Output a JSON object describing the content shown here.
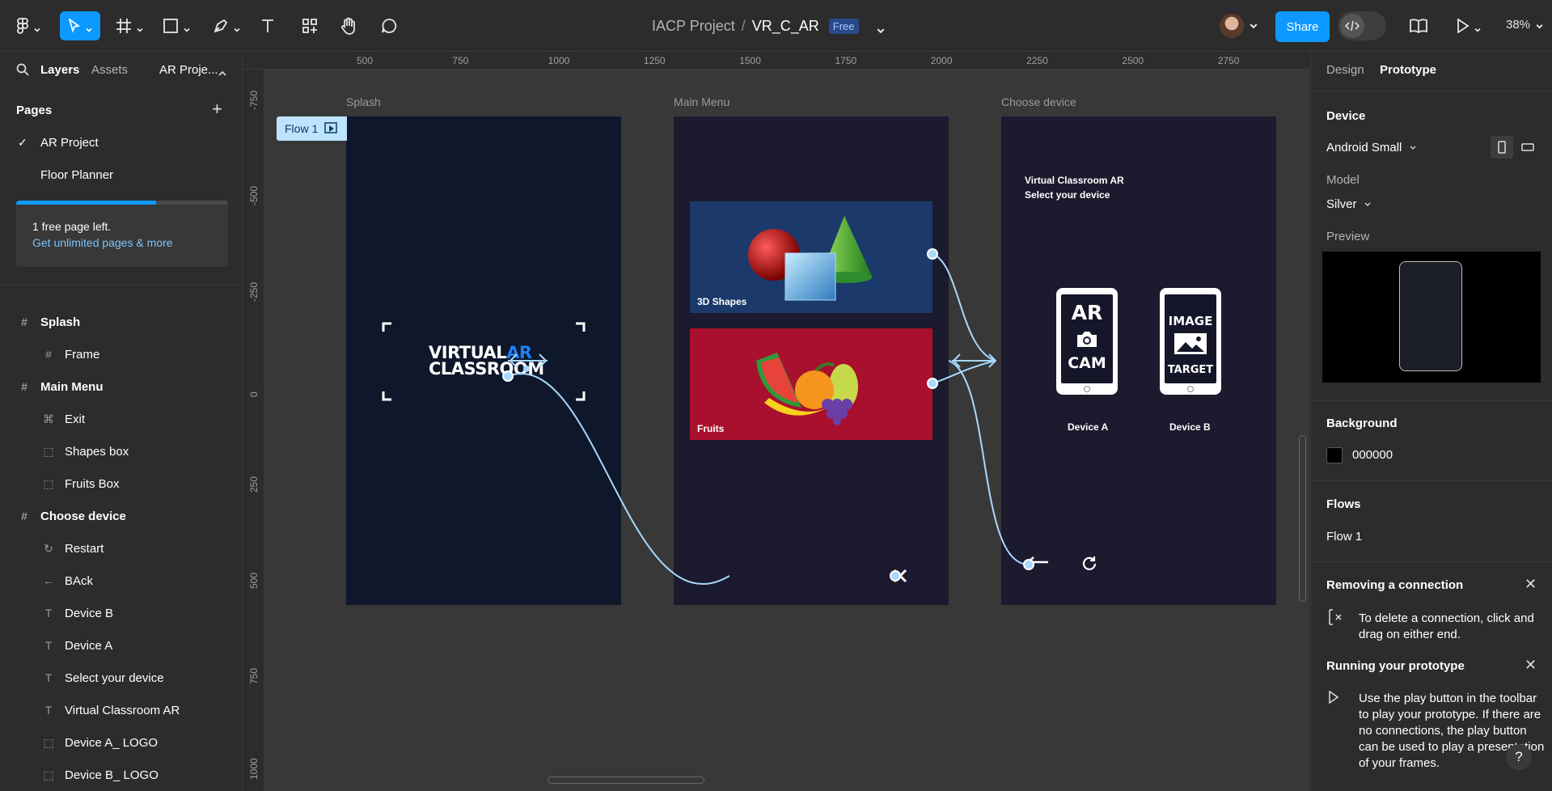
{
  "toolbar": {
    "project": "IACP Project",
    "separator": "/",
    "file": "VR_C_AR",
    "plan_badge": "Free",
    "share_label": "Share",
    "zoom": "38%"
  },
  "left_panel": {
    "tabs": {
      "layers": "Layers",
      "assets": "Assets",
      "page_switch": "AR Proje..."
    },
    "pages_title": "Pages",
    "pages": [
      {
        "label": "AR Project",
        "active": true
      },
      {
        "label": "Floor Planner",
        "active": false
      }
    ],
    "upsell": {
      "text": "1 free page left.",
      "link": "Get unlimited pages & more",
      "progress": 0.66
    },
    "layers": [
      {
        "label": "Splash",
        "icon": "frame-icon",
        "glyph": "#",
        "level": 0
      },
      {
        "label": "Frame",
        "icon": "frame-icon",
        "glyph": "#",
        "level": 1
      },
      {
        "label": "Main Menu",
        "icon": "frame-icon",
        "glyph": "#",
        "level": 0
      },
      {
        "label": "Exit",
        "icon": "component-icon",
        "glyph": "⌘",
        "level": 1
      },
      {
        "label": "Shapes box",
        "icon": "group-icon",
        "glyph": "⬚",
        "level": 1
      },
      {
        "label": "Fruits Box",
        "icon": "group-icon",
        "glyph": "⬚",
        "level": 1
      },
      {
        "label": "Choose device",
        "icon": "frame-icon",
        "glyph": "#",
        "level": 0
      },
      {
        "label": "Restart",
        "icon": "restart-icon",
        "glyph": "↻",
        "level": 1
      },
      {
        "label": "BAck",
        "icon": "arrow-left-icon",
        "glyph": "←",
        "level": 1
      },
      {
        "label": "Device B",
        "icon": "text-icon",
        "glyph": "T",
        "level": 1
      },
      {
        "label": "Device A",
        "icon": "text-icon",
        "glyph": "T",
        "level": 1
      },
      {
        "label": "Select your device",
        "icon": "text-icon",
        "glyph": "T",
        "level": 1
      },
      {
        "label": "Virtual Classroom AR",
        "icon": "text-icon",
        "glyph": "T",
        "level": 1
      },
      {
        "label": "Device A_ LOGO",
        "icon": "group-icon",
        "glyph": "⬚",
        "level": 1
      },
      {
        "label": "Device B_ LOGO",
        "icon": "group-icon",
        "glyph": "⬚",
        "level": 1
      }
    ]
  },
  "rulers": {
    "top": [
      "500",
      "750",
      "1000",
      "1250",
      "1500",
      "1750",
      "2000",
      "2250",
      "2500",
      "2750"
    ],
    "left": [
      "-750",
      "-500",
      "-250",
      "0",
      "250",
      "500",
      "750",
      "1000"
    ]
  },
  "canvas": {
    "flow_badge": "Flow 1",
    "frames": {
      "splash": {
        "label": "Splash",
        "bg": "#0f172a"
      },
      "main_menu": {
        "label": "Main Menu",
        "bg": "#1b1a2e"
      },
      "choose_device": {
        "label": "Choose device",
        "bg": "#1b1a2e"
      }
    },
    "logo": {
      "line1_a": "VIRTUAL",
      "line1_b": "AR",
      "line2": "CLASSROOM"
    },
    "cards": {
      "shapes": "3D Shapes",
      "fruits": "Fruits"
    },
    "choose": {
      "title": "Virtual Classroom AR",
      "subtitle": "Select your device",
      "device_a": {
        "line1": "AR",
        "line2": "CAM",
        "label": "Device A"
      },
      "device_b": {
        "line1": "IMAGE",
        "line2": "TARGET",
        "label": "Device B"
      }
    }
  },
  "right_panel": {
    "tabs": {
      "design": "Design",
      "prototype": "Prototype"
    },
    "device_title": "Device",
    "device_value": "Android Small",
    "model_label": "Model",
    "model_value": "Silver",
    "preview_label": "Preview",
    "background_title": "Background",
    "background_hex": "000000",
    "flows_title": "Flows",
    "flow_item": "Flow 1",
    "tip1": {
      "title": "Removing a connection",
      "text": "To delete a connection, click and drag on either end."
    },
    "tip2": {
      "title": "Running your prototype",
      "text": "Use the play button in the toolbar to play your prototype. If there are no connections, the play button can be used to play a presentation of your frames."
    },
    "help": "?"
  },
  "colors": {
    "accent": "#0d99ff",
    "connector": "#a8d8ff",
    "fruits_card": "#a8102e",
    "shapes_card": "#1b3a6b"
  }
}
